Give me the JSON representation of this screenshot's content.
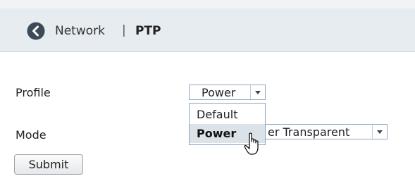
{
  "breadcrumb": {
    "parent": "Network",
    "separator": "|",
    "current": "PTP"
  },
  "form": {
    "profile": {
      "label": "Profile",
      "selected": "Power",
      "options": [
        "Default",
        "Power"
      ],
      "highlighted_option": "Power"
    },
    "mode": {
      "label": "Mode",
      "visible_value": "er Transparent"
    },
    "submit_label": "Submit"
  },
  "colors": {
    "header_bg": "#e7ecf0",
    "back_icon": "#3d4a57",
    "select_border": "#8fa6bd",
    "highlight_bg": "#dbe3ea"
  },
  "icons": {
    "back": "chevron-left-circle-icon",
    "dropdown": "caret-down-icon",
    "cursor": "hand-pointer-cursor"
  }
}
